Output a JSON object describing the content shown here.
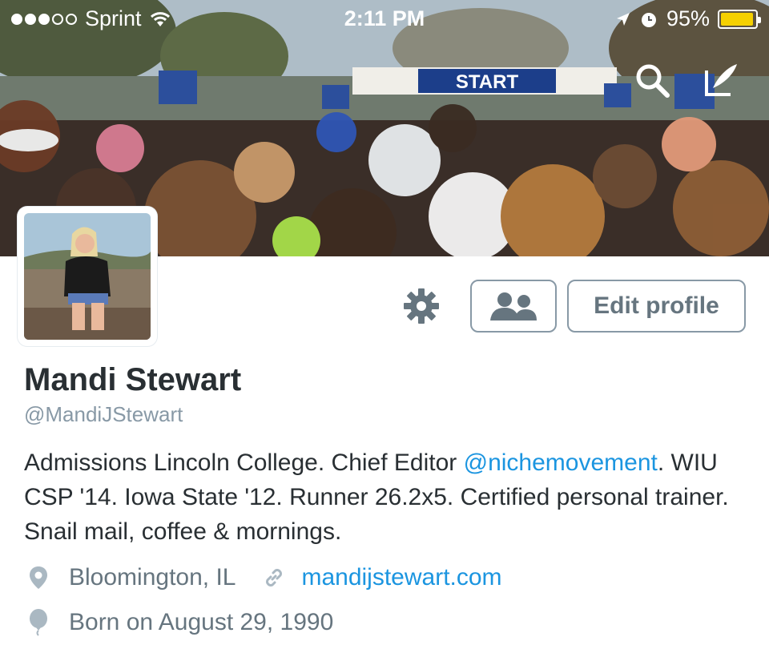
{
  "status_bar": {
    "carrier": "Sprint",
    "time": "2:11 PM",
    "battery_percent": "95%",
    "battery_level": 0.95,
    "icons": [
      "signal-dots-icon",
      "wifi-icon",
      "location-arrow-icon",
      "alarm-icon",
      "battery-icon"
    ]
  },
  "header": {
    "banner_text": "START",
    "actions": [
      "search-icon",
      "compose-icon"
    ]
  },
  "profile": {
    "name": "Mandi Stewart",
    "handle": "@MandiJStewart",
    "bio_part1": "Admissions Lincoln College. Chief Editor ",
    "bio_mention": "@nichemovement",
    "bio_part2": ". WIU CSP '14. Iowa State '12. Runner 26.2x5. Certified personal trainer. Snail mail, coffee & mornings.",
    "location": "Bloomington, IL",
    "website": "mandijstewart.com",
    "birthday": "Born on August 29, 1990"
  },
  "actions": {
    "edit_profile_label": "Edit profile",
    "icons": [
      "gear-icon",
      "people-icon"
    ]
  },
  "colors": {
    "accent": "#1b95e0",
    "muted_text": "#66757f",
    "button_border": "#8899a6",
    "battery": "#f5d000"
  }
}
